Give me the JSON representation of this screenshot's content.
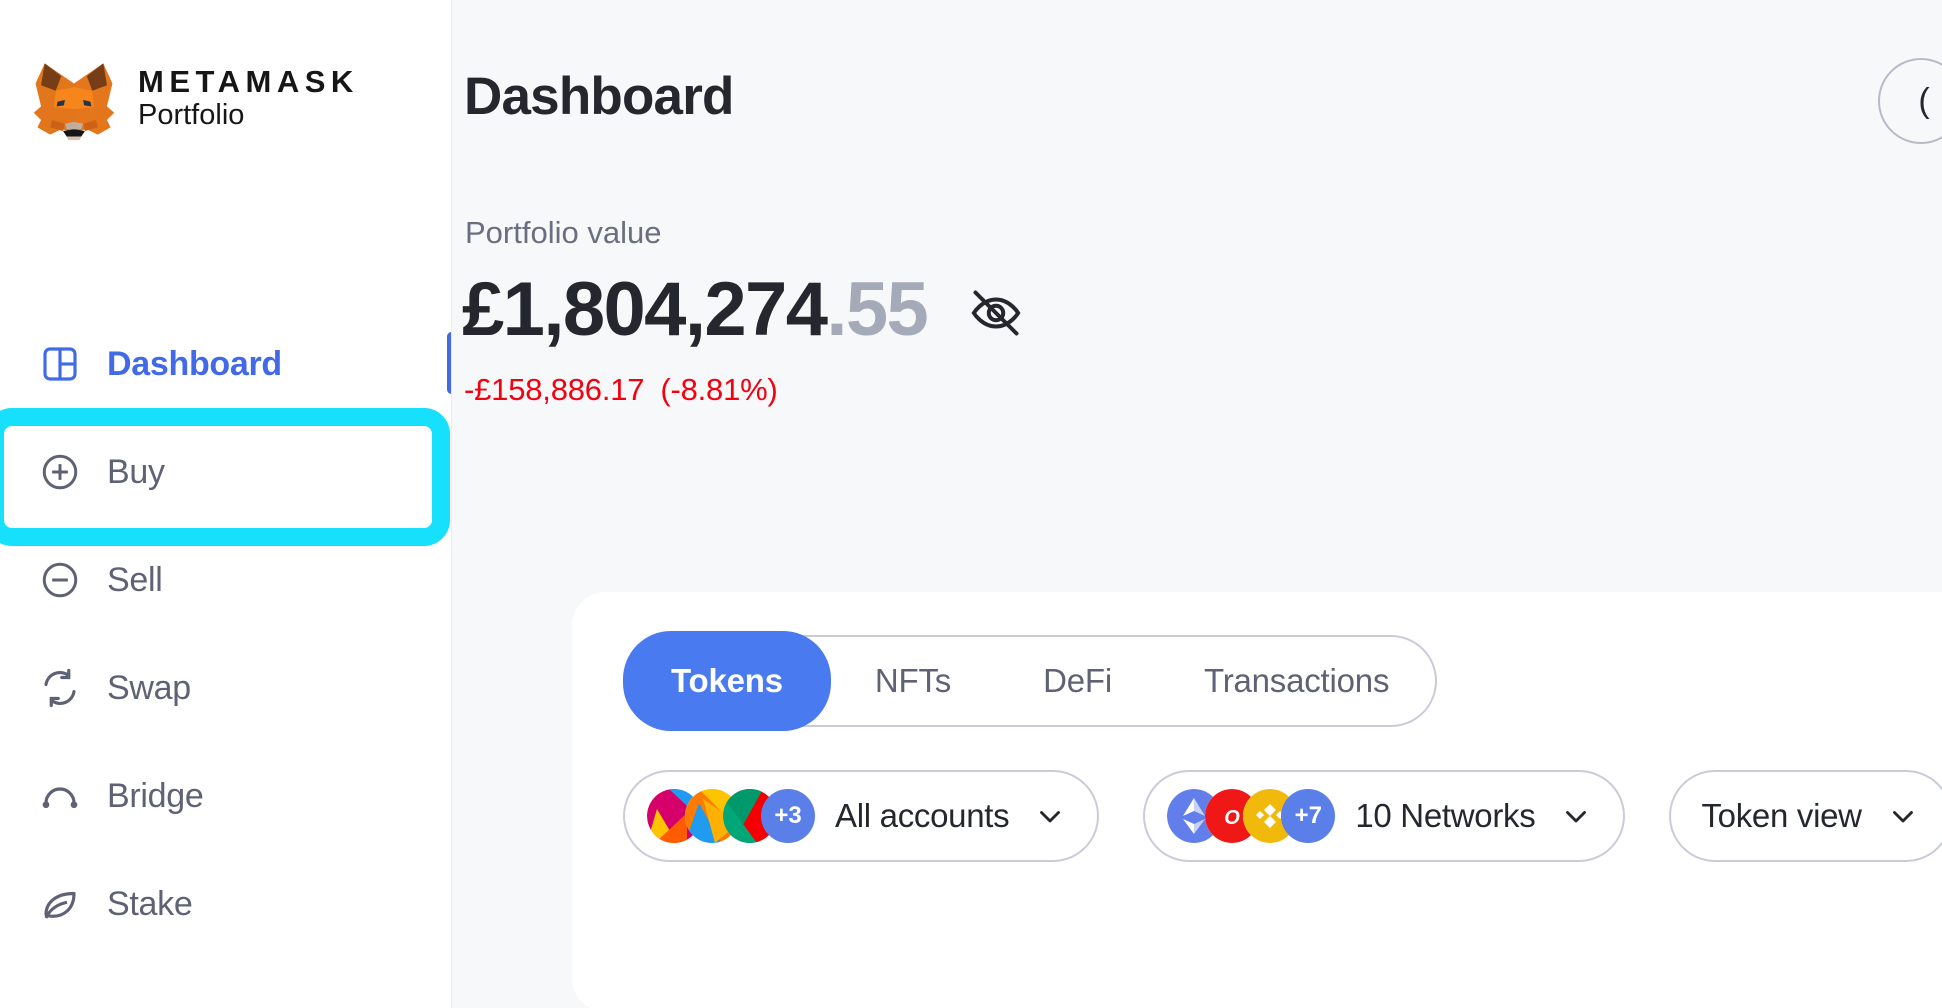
{
  "brand": {
    "title": "METAMASK",
    "subtitle": "Portfolio",
    "logo_icon": "metamask-fox-logo"
  },
  "sidebar": {
    "items": [
      {
        "label": "Dashboard",
        "icon": "dashboard-icon",
        "active": true
      },
      {
        "label": "Buy",
        "icon": "plus-circle-icon",
        "active": false
      },
      {
        "label": "Sell",
        "icon": "minus-circle-icon",
        "active": false
      },
      {
        "label": "Swap",
        "icon": "swap-arrows-icon",
        "active": false
      },
      {
        "label": "Bridge",
        "icon": "bridge-icon",
        "active": false
      },
      {
        "label": "Stake",
        "icon": "leaf-icon",
        "active": false
      }
    ],
    "highlighted_item": "Buy",
    "highlight_color": "#16e0fb"
  },
  "header": {
    "title": "Dashboard",
    "account_button_icon": "account-circle-icon"
  },
  "portfolio": {
    "label": "Portfolio value",
    "value_whole": "£1,804,274",
    "value_cents": ".55",
    "change_amount": "-£158,886.17",
    "change_percent": "(-8.81%)",
    "change_color": "#f5000f",
    "hide_balance_icon": "eye-off-icon"
  },
  "tabs": [
    {
      "label": "Tokens",
      "active": true
    },
    {
      "label": "NFTs",
      "active": false
    },
    {
      "label": "DeFi",
      "active": false
    },
    {
      "label": "Transactions",
      "active": false
    }
  ],
  "filters": {
    "accounts": {
      "label": "All accounts",
      "badge": "+3",
      "chevron_icon": "chevron-down-icon"
    },
    "networks": {
      "label": "10 Networks",
      "badge": "+7",
      "chevron_icon": "chevron-down-icon"
    },
    "view": {
      "label": "Token view",
      "chevron_icon": "chevron-down-icon"
    }
  },
  "colors": {
    "accent": "#4169e8",
    "tab_active": "#4a7af0",
    "page_bg": "#f7f8fa",
    "card_bg": "#ffffff",
    "text_dark": "#24272e",
    "text_muted": "#5f6274"
  }
}
